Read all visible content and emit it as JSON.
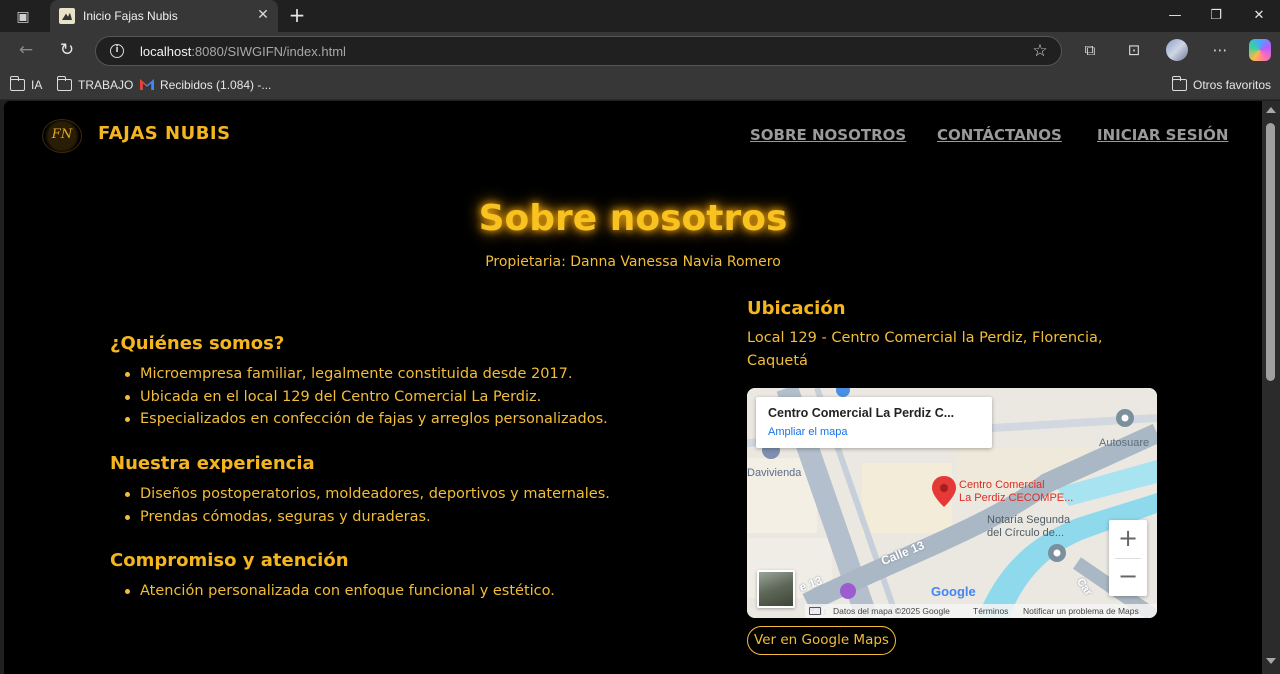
{
  "browser": {
    "tab_title": "Inicio Fajas Nubis",
    "url_host": "localhost",
    "url_rest": ":8080/SIWGIFN/index.html",
    "bookmarks": [
      {
        "label": "IA"
      },
      {
        "label": "TRABAJO"
      },
      {
        "label": "Recibidos (1.084) -..."
      },
      {
        "label": "Otros favoritos"
      }
    ]
  },
  "site": {
    "logo_text": "FN",
    "brand": "FAJAS NUBIS",
    "nav": {
      "about": "SOBRE NOSOTROS",
      "contact": "CONTÁCTANOS",
      "login": "INICIAR SESIÓN"
    }
  },
  "hero": {
    "title": "Sobre nosotros",
    "subtitle": "Propietaria: Danna Vanessa Navia Romero"
  },
  "sections": [
    {
      "heading": "¿Quiénes somos?",
      "items": [
        "Microempresa familiar, legalmente constituida desde 2017.",
        "Ubicada en el local 129 del Centro Comercial La Perdiz.",
        "Especializados en confección de fajas y arreglos personalizados."
      ]
    },
    {
      "heading": "Nuestra experiencia",
      "items": [
        "Diseños postoperatorios, moldeadores, deportivos y maternales.",
        "Prendas cómodas, seguras y duraderas."
      ]
    },
    {
      "heading": "Compromiso y atención",
      "items": [
        "Atención personalizada con enfoque funcional y estético."
      ]
    }
  ],
  "location": {
    "heading": "Ubicación",
    "address": "Local 129 - Centro Comercial la Perdiz, Florencia, Caquetá",
    "map": {
      "card_title": "Centro Comercial La Perdiz C...",
      "card_link": "Ampliar el mapa",
      "pin_label_1": "Centro Comercial",
      "pin_label_2": "La Perdiz CECOMPE...",
      "place_autosuare": "Autosuare",
      "place_davivienda": "Davivienda",
      "place_notaria_1": "Notaría Segunda",
      "place_notaria_2": "del Círculo de...",
      "street_calle13": "Calle 13",
      "street_13": "e 13",
      "place_mu": "Mu",
      "place_car": "Car",
      "zoom_in": "+",
      "zoom_out": "−",
      "google": "Google",
      "footer_data": "Datos del mapa ©2025 Google",
      "footer_terms": "Términos",
      "footer_report": "Notificar un problema de Maps",
      "colors": {
        "water": "#8fd9ec",
        "road": "#aab7c4",
        "pin": "#e53935"
      }
    },
    "gmaps_button": "Ver en Google Maps"
  }
}
